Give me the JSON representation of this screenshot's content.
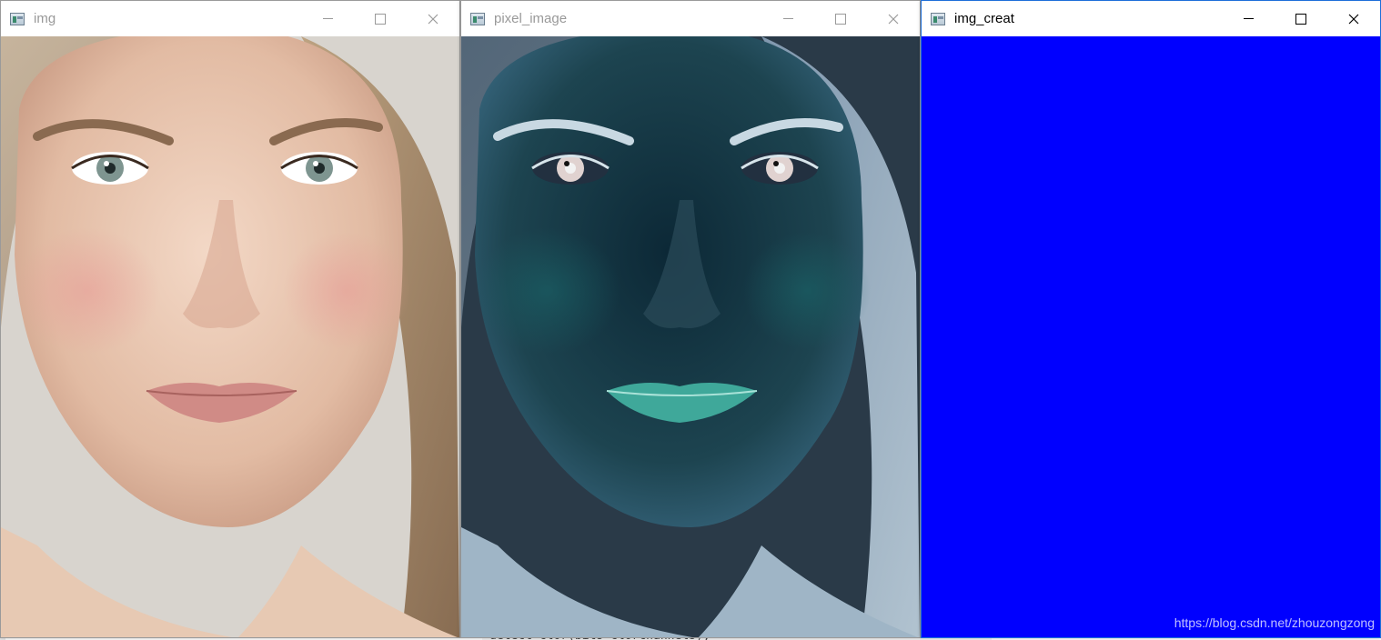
{
  "windows": {
    "img": {
      "title": "img"
    },
    "pixel_image": {
      "title": "pixel_image"
    },
    "img_creat": {
      "title": "img_creat",
      "fill_color": "#0000ff"
    }
  },
  "controls": {
    "minimize_icon": "minimize-icon",
    "maximize_icon": "maximize-icon",
    "close_icon": "close-icon"
  },
  "watermark": "https://blog.csdn.net/zhouzongzong",
  "background_text": "detect clor(bits clorchannels),"
}
